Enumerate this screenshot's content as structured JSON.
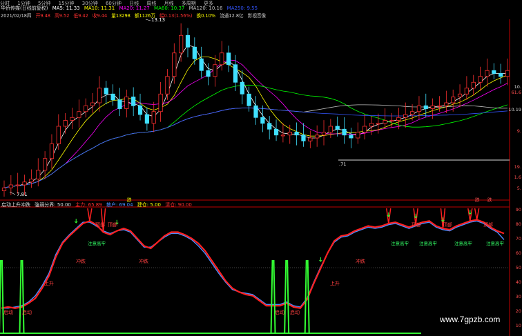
{
  "tabs": [
    "分时",
    "1分钟",
    "5分钟",
    "15分钟",
    "30分钟",
    "60分钟",
    "日线",
    "周线",
    "月线",
    "多周期",
    "更多"
  ],
  "header": {
    "stock_name": "华侨传媒(日线前复权)",
    "ma_items": [
      {
        "label": "MA5: 11.33",
        "color": "#ffffff"
      },
      {
        "label": "MA10: 11.31",
        "color": "#ffff00"
      },
      {
        "label": "MA20: 11.27",
        "color": "#ff00ff"
      },
      {
        "label": "MA60: 10.37",
        "color": "#00ff00"
      },
      {
        "label": "MA120: 10.16",
        "color": "#c0c0c0"
      },
      {
        "label": "MA250: 9.55",
        "color": "#3355ff"
      }
    ]
  },
  "info_bar": [
    {
      "text": "2021/02/18四",
      "color": "#cccccc"
    },
    {
      "text": "开9.48",
      "color": "#ff3030"
    },
    {
      "text": "高9.52",
      "color": "#ff3030"
    },
    {
      "text": "低9.42",
      "color": "#ff3030"
    },
    {
      "text": "收9.44",
      "color": "#ff3030"
    },
    {
      "text": "量13298",
      "color": "#ffff00"
    },
    {
      "text": "额1126万",
      "color": "#ffff00"
    },
    {
      "text": "幅0.13(1.56%)",
      "color": "#ff3030"
    },
    {
      "text": "换0.10%",
      "color": "#ffff00"
    },
    {
      "text": "流通12.8亿",
      "color": "#cccccc"
    },
    {
      "text": "影视音像",
      "color": "#cccccc"
    }
  ],
  "price_annotations": {
    "high": "13.13",
    "low": "7.81",
    "mid": ".71"
  },
  "price_axis": [
    "10.",
    "61.6",
    "10.19",
    "9.",
    "19.",
    "1.6",
    "5."
  ],
  "indicator": {
    "name": "启动上升冲跌",
    "params": [
      {
        "text": "強弱分界: 50.00",
        "color": "#dddddd"
      },
      {
        "text": "主力: 65.89",
        "color": "#ff3030"
      },
      {
        "text": "散户: 69.04",
        "color": "#4a8cff"
      },
      {
        "text": "建仓: 5.00",
        "color": "#ffff00"
      },
      {
        "text": "清仓: 90.00",
        "color": "#ff3030"
      }
    ],
    "labels": {
      "start": "启动",
      "rise": "上升",
      "drop": "冲跌",
      "top": "顶部",
      "warn": "注意高牢",
      "sell_marker": "跌"
    },
    "axis": [
      "90",
      "80",
      "70",
      "60",
      "50",
      "40",
      "30",
      "20",
      "10"
    ]
  },
  "chart_data": [
    {
      "type": "candlestick",
      "title": "华侨传媒(日线前复权)",
      "series_main": {
        "name": "price",
        "values": [
          7.8,
          7.9,
          7.9,
          8.0,
          8.1,
          8.4,
          8.8,
          9.3,
          9.9,
          10.1,
          10.2,
          10.4,
          10.6,
          10.7,
          11.2,
          11.0,
          10.8,
          10.5,
          10.9,
          10.6,
          10.3,
          10.0,
          10.4,
          11.0,
          11.6,
          12.4,
          13.0,
          12.6,
          12.2,
          11.8,
          11.6,
          12.0,
          12.4,
          12.0,
          11.4,
          11.0,
          10.6,
          10.2,
          10.0,
          9.8,
          9.6,
          9.6,
          9.7,
          9.6,
          9.4,
          9.5,
          9.6,
          9.7,
          9.9,
          9.8,
          9.6,
          9.5,
          9.7,
          9.9,
          10.0,
          10.0,
          10.1,
          10.1,
          10.2,
          10.3,
          10.4,
          10.6,
          10.5,
          10.6,
          10.6,
          10.7,
          10.9,
          11.0,
          11.2,
          11.4,
          11.6,
          11.8,
          11.7,
          11.6,
          11.8
        ]
      },
      "ma_lines": [
        "MA5",
        "MA10",
        "MA20",
        "MA60",
        "MA120",
        "MA250"
      ]
    },
    {
      "type": "line",
      "title": "启动上升冲跌",
      "series": [
        {
          "name": "主力",
          "values": [
            14,
            15,
            14,
            15,
            18,
            22,
            30,
            40,
            55,
            66,
            72,
            77,
            82,
            84,
            81,
            75,
            73,
            76,
            78,
            76,
            70,
            64,
            62,
            67,
            72,
            75,
            75,
            73,
            70,
            66,
            60,
            52,
            44,
            36,
            30,
            27,
            25,
            24,
            20,
            16,
            16,
            16,
            18,
            15,
            14,
            21,
            34,
            46,
            58,
            68,
            72,
            73,
            76,
            78,
            80,
            79,
            80,
            82,
            83,
            81,
            79,
            81,
            83,
            84,
            80,
            78,
            77,
            80,
            82,
            84,
            85,
            83,
            79,
            76,
            74
          ]
        },
        {
          "name": "散户",
          "values": [
            14,
            14,
            15,
            16,
            19,
            24,
            32,
            42,
            57,
            67,
            73,
            78,
            83,
            83,
            80,
            76,
            74,
            76,
            77,
            75,
            69,
            63,
            63,
            67,
            71,
            74,
            74,
            72,
            69,
            64,
            58,
            50,
            42,
            35,
            29,
            27,
            26,
            25,
            21,
            17,
            17,
            17,
            19,
            16,
            15,
            22,
            35,
            47,
            58,
            67,
            71,
            72,
            75,
            77,
            79,
            78,
            79,
            81,
            82,
            80,
            78,
            80,
            82,
            83,
            79,
            77,
            76,
            79,
            81,
            83,
            84,
            82,
            78,
            75,
            69
          ]
        }
      ],
      "ylim": [
        0,
        100
      ]
    }
  ]
}
